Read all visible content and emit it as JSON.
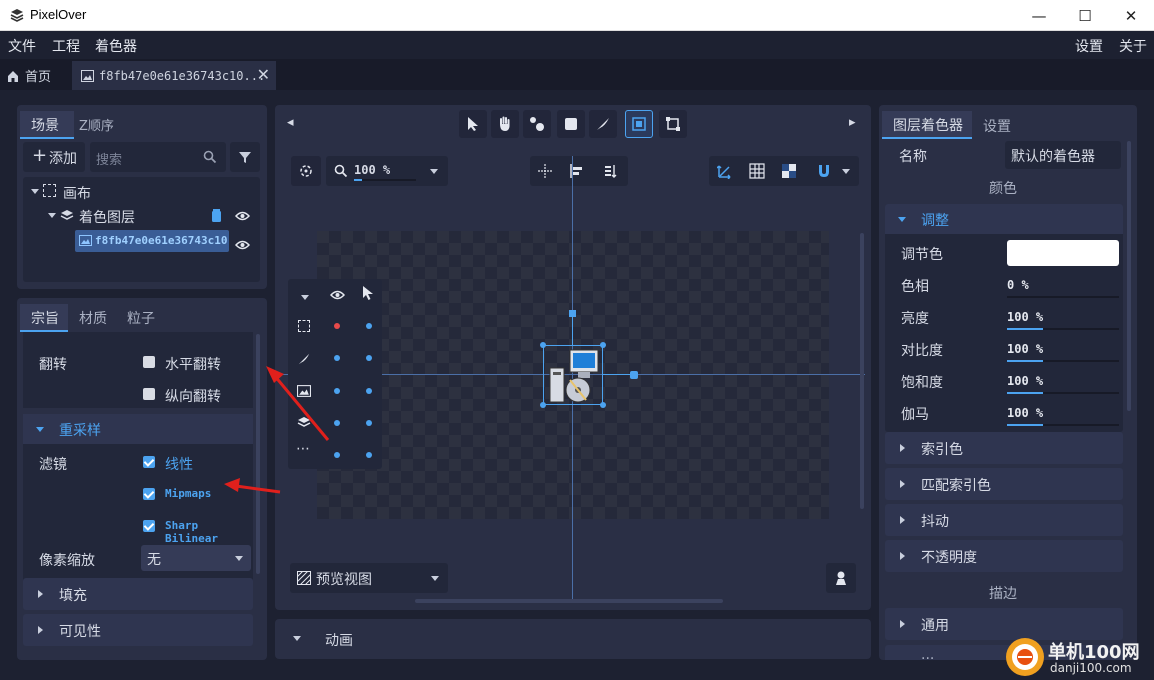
{
  "window": {
    "title": "PixelOver",
    "minimize": "—",
    "maximize": "☐",
    "close": "✕"
  },
  "menu": {
    "file": "文件",
    "project": "工程",
    "shader": "着色器",
    "settings": "设置",
    "about": "关于"
  },
  "tabs": {
    "home": "首页",
    "doc": "f8fb47e0e61e36743c10...",
    "close": "✕"
  },
  "scene": {
    "tab_scene": "场景",
    "tab_zorder": "Z顺序",
    "add_label": "添加",
    "search_placeholder": "搜索",
    "tree": {
      "canvas": "画布",
      "shader_layer": "着色图层",
      "image": "f8fb47e0e61e36743c10"
    }
  },
  "props": {
    "tab_main": "宗旨",
    "tab_material": "材质",
    "tab_particle": "粒子",
    "flip_label": "翻转",
    "flip_h": "水平翻转",
    "flip_v": "纵向翻转",
    "resample_title": "重采样",
    "filter_label": "滤镜",
    "filter_linear": "线性",
    "filter_mipmaps": "Mipmaps",
    "filter_bilinear": "Sharp Bilinear",
    "pixel_scale_label": "像素缩放",
    "pixel_scale_value": "无",
    "fill_title": "填充",
    "visibility_title": "可见性"
  },
  "viewport": {
    "zoom": "100 %",
    "preview_label": "预览视图",
    "anim_label": "动画",
    "nav_left": "◂",
    "nav_right": "▸"
  },
  "shader_panel": {
    "tab_layer_shader": "图层着色器",
    "tab_settings": "设置",
    "name_label": "名称",
    "name_value": "默认的着色器",
    "color_section": "颜色",
    "adjust_title": "调整",
    "tint_label": "调节色",
    "tint_color": "#ffffff",
    "sliders": [
      {
        "label": "色相",
        "value": "0 %",
        "fill": 0
      },
      {
        "label": "亮度",
        "value": "100 %",
        "fill": 0.32
      },
      {
        "label": "对比度",
        "value": "100 %",
        "fill": 0.32
      },
      {
        "label": "饱和度",
        "value": "100 %",
        "fill": 0.32
      },
      {
        "label": "伽马",
        "value": "100 %",
        "fill": 0.32
      }
    ],
    "index_color": "索引色",
    "match_index_color": "匹配索引色",
    "dither": "抖动",
    "opacity": "不透明度",
    "stroke_section": "描边",
    "general": "通用",
    "more": "..."
  },
  "watermark": {
    "text": "单机100网",
    "url": "danji100.com"
  },
  "colors": {
    "accent": "#4ca3f0",
    "panel": "#2a2f45",
    "bg": "#1d2131",
    "annotation_arrow": "#e0201c"
  }
}
